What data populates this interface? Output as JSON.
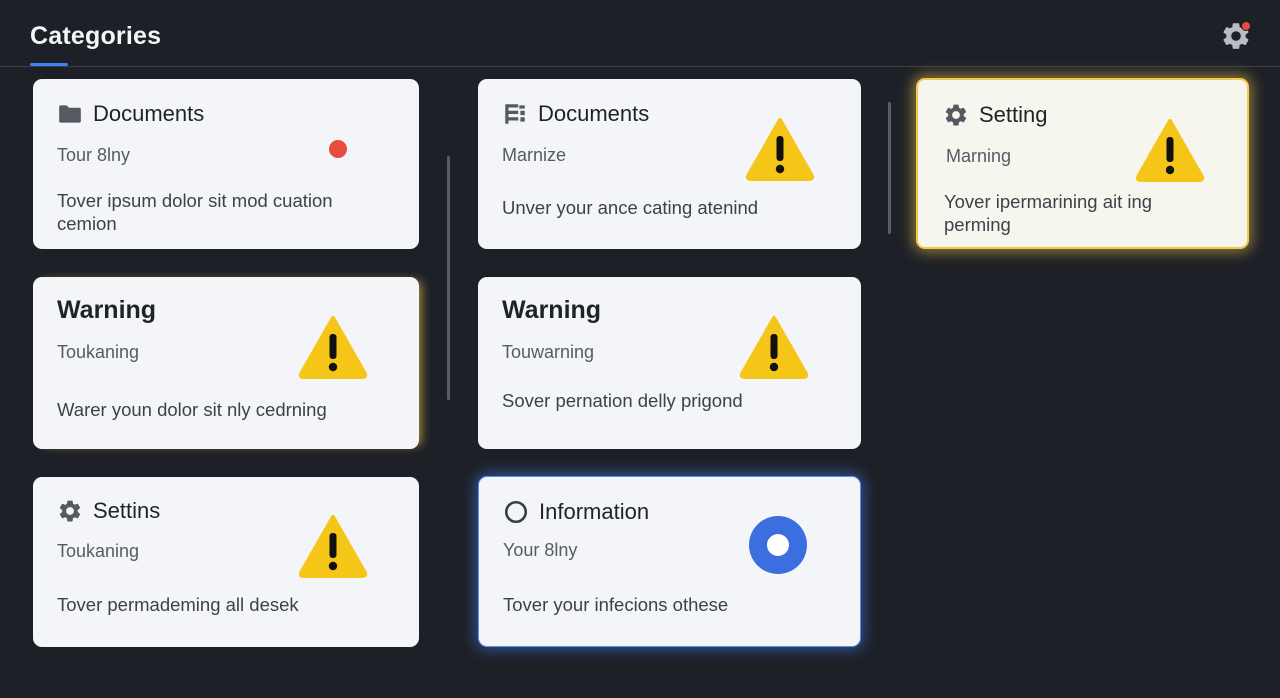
{
  "header": {
    "title": "Categories",
    "settings_icon": "gear-icon",
    "accent_color": "#3b82f6",
    "notification_dot_color": "#e74c3c"
  },
  "cards": [
    {
      "title": "Documents",
      "icon": "folder-icon",
      "subtitle": "Tour 8lny",
      "description": "Tover ipsum dolor sit mod cuation cemion",
      "status": "red-dot"
    },
    {
      "title": "Documents",
      "icon": "document-grid-icon",
      "subtitle": "Marnize",
      "description": "Unver your ance cating atenind",
      "status": "warning-icon"
    },
    {
      "title": "Setting",
      "icon": "gear-icon",
      "subtitle": "Marning",
      "description": "Yover ipermarining ait ing perming",
      "status": "warning-icon",
      "highlight": "yellow"
    },
    {
      "title": "Warning",
      "subtitle": "Toukaning",
      "description": "Warer youn dolor sit nly cedrning",
      "status": "warning-icon"
    },
    {
      "title": "Warning",
      "subtitle": "Touwarning",
      "description": "Sover pernation delly prigond",
      "status": "warning-icon"
    },
    {
      "title": "Settins",
      "icon": "gear-icon",
      "subtitle": "Toukaning",
      "description": "Tover permademing all desek",
      "status": "warning-icon"
    },
    {
      "title": "Information",
      "icon": "circle-outline-icon",
      "subtitle": "Your 8lny",
      "description": "Tover your infecions othese",
      "status": "info-ring-icon",
      "highlight": "blue"
    }
  ],
  "colors": {
    "background": "#1d2027",
    "card": "#f3f5f8",
    "warning": "#f5c518",
    "info": "#3b6fe0",
    "red_dot": "#e84c3d"
  }
}
